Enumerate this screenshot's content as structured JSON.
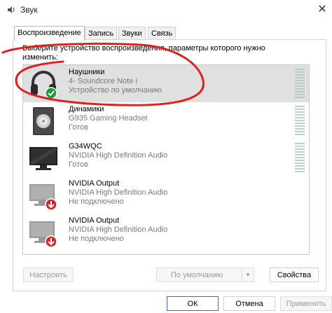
{
  "window": {
    "title": "Звук",
    "close_glyph": "✕"
  },
  "tabs": [
    {
      "label": "Воспроизведение",
      "active": true
    },
    {
      "label": "Запись",
      "active": false
    },
    {
      "label": "Звуки",
      "active": false
    },
    {
      "label": "Связь",
      "active": false
    }
  ],
  "instruction": "Выберите устройство воспроизведения, параметры которого нужно изменить:",
  "devices": [
    {
      "name": "Наушники",
      "sub": "4- Soundcore Note i",
      "status": "Устройство по умолчанию",
      "icon": "headphones-icon",
      "badge": "default-check",
      "selected": true
    },
    {
      "name": "Динамики",
      "sub": "G935 Gaming Headset",
      "status": "Готов",
      "icon": "speaker-icon",
      "badge": "",
      "selected": false
    },
    {
      "name": "G34WQC",
      "sub": "NVIDIA High Definition Audio",
      "status": "Готов",
      "icon": "monitor-icon",
      "badge": "",
      "selected": false
    },
    {
      "name": "NVIDIA Output",
      "sub": "NVIDIA High Definition Audio",
      "status": "Не подключено",
      "icon": "monitor-icon",
      "badge": "disconnected-arrow",
      "selected": false
    },
    {
      "name": "NVIDIA Output",
      "sub": "NVIDIA High Definition Audio",
      "status": "Не подключено",
      "icon": "monitor-icon",
      "badge": "disconnected-arrow",
      "selected": false
    }
  ],
  "buttons": {
    "configure": "Настроить",
    "set_default": "По умолчанию",
    "properties": "Свойства",
    "ok": "ОК",
    "cancel": "Отмена",
    "apply": "Применить"
  },
  "colors": {
    "selection": "#e0e0e0",
    "check_badge": "#1a9b3c",
    "disconnected_badge": "#d32626",
    "annotation_ink": "#e02020",
    "primary_border": "#2f6fd6"
  }
}
